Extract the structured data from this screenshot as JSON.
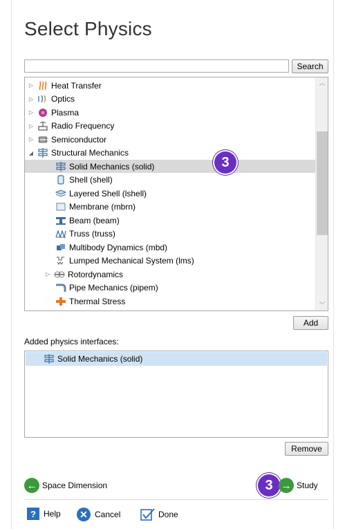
{
  "title": "Select Physics",
  "search": {
    "value": "",
    "placeholder": "",
    "button_label": "Search"
  },
  "tree": {
    "items": [
      {
        "label": "Heat Transfer",
        "icon": "heat-transfer-icon",
        "expander": "▷",
        "selected": false
      },
      {
        "label": "Optics",
        "icon": "optics-icon",
        "expander": "▷",
        "selected": false
      },
      {
        "label": "Plasma",
        "icon": "plasma-icon",
        "expander": "▷",
        "selected": false
      },
      {
        "label": "Radio Frequency",
        "icon": "radio-frequency-icon",
        "expander": "▷",
        "selected": false
      },
      {
        "label": "Semiconductor",
        "icon": "semiconductor-icon",
        "expander": "▷",
        "selected": false
      },
      {
        "label": "Structural Mechanics",
        "icon": "structural-mechanics-icon",
        "expander": "◢",
        "selected": false
      },
      {
        "label": "Solid Mechanics (solid)",
        "icon": "solid-mechanics-icon",
        "expander": "",
        "selected": true
      },
      {
        "label": "Shell (shell)",
        "icon": "shell-icon",
        "expander": "",
        "selected": false
      },
      {
        "label": "Layered Shell (lshell)",
        "icon": "layered-shell-icon",
        "expander": "",
        "selected": false
      },
      {
        "label": "Membrane (mbrn)",
        "icon": "membrane-icon",
        "expander": "",
        "selected": false
      },
      {
        "label": "Beam (beam)",
        "icon": "beam-icon",
        "expander": "",
        "selected": false
      },
      {
        "label": "Truss (truss)",
        "icon": "truss-icon",
        "expander": "",
        "selected": false
      },
      {
        "label": "Multibody Dynamics (mbd)",
        "icon": "multibody-dynamics-icon",
        "expander": "",
        "selected": false
      },
      {
        "label": "Lumped Mechanical System (lms)",
        "icon": "lumped-mechanical-icon",
        "expander": "",
        "selected": false
      },
      {
        "label": "Rotordynamics",
        "icon": "rotordynamics-icon",
        "expander": "▷",
        "selected": false
      },
      {
        "label": "Pipe Mechanics (pipem)",
        "icon": "pipe-mechanics-icon",
        "expander": "",
        "selected": false
      },
      {
        "label": "Thermal Stress",
        "icon": "thermal-stress-icon",
        "expander": "",
        "selected": false
      }
    ],
    "scroll_position": 0.4,
    "step_badge": "3"
  },
  "add_button": "Add",
  "added_section": {
    "label": "Added physics interfaces:",
    "items": [
      {
        "label": "Solid Mechanics (solid)",
        "icon": "solid-mechanics-icon"
      }
    ]
  },
  "remove_button": "Remove",
  "nav": {
    "back_label": "Space Dimension",
    "next_label": "Study",
    "step_badge": "3"
  },
  "footer": {
    "help_label": "Help",
    "cancel_label": "Cancel",
    "done_label": "Done"
  },
  "colors": {
    "accent_green": "#3c9a3c",
    "badge_purple": "#6a2fc2",
    "selection_gray": "#d9d9d9",
    "selection_blue": "#cfe3f5",
    "icon_blue": "#2b6fbe"
  }
}
